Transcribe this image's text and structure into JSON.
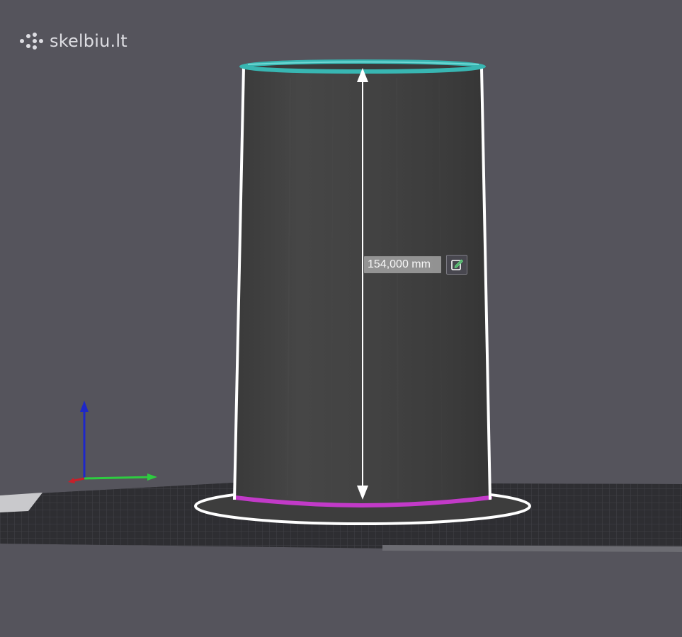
{
  "watermark": {
    "text": "skelbiu.lt",
    "icon": "dots-grid-logo-icon"
  },
  "measurement": {
    "value_label": "154,000 mm",
    "edit_icon": "edit-pencil-icon"
  },
  "model": {
    "top_edge_color": "#38b6b2",
    "bottom_edge_color": "#c23ac8",
    "body_color": "#3f3f3f",
    "outline_color": "#ffffff"
  },
  "axes": {
    "x_color": "#c8202a",
    "y_color": "#2ecc40",
    "z_color": "#1e28c8"
  },
  "background_color": "#55545c",
  "bed_color": "#2d2d31"
}
